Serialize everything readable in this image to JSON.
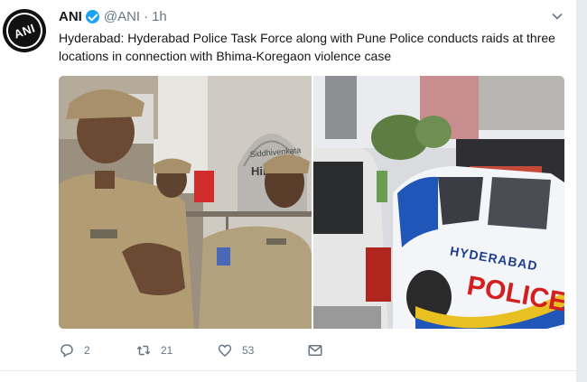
{
  "tweet": {
    "author_name": "ANI",
    "author_handle": "@ANI",
    "separator": "·",
    "time": "1h",
    "avatar_text": "ANI",
    "text": "Hyderabad: Hyderabad Police Task Force along with Pune Police conducts raids at three locations in connection with Bhima-Koregaon violence case",
    "media": {
      "left_image": {
        "building_sign_1": "Siddhivenkata",
        "building_sign_2": "Hima S"
      },
      "right_image": {
        "car_text_1": "HYDERABAD",
        "car_text_2": "POLICE"
      }
    },
    "actions": {
      "reply_count": "2",
      "retweet_count": "21",
      "like_count": "53"
    }
  },
  "icons": {
    "verified": "verified-badge-icon",
    "caret": "chevron-down-icon",
    "reply": "reply-icon",
    "retweet": "retweet-icon",
    "like": "heart-icon",
    "dm": "envelope-icon"
  },
  "colors": {
    "accent": "#1da1f2",
    "text": "#14171a",
    "secondary": "#657786"
  }
}
